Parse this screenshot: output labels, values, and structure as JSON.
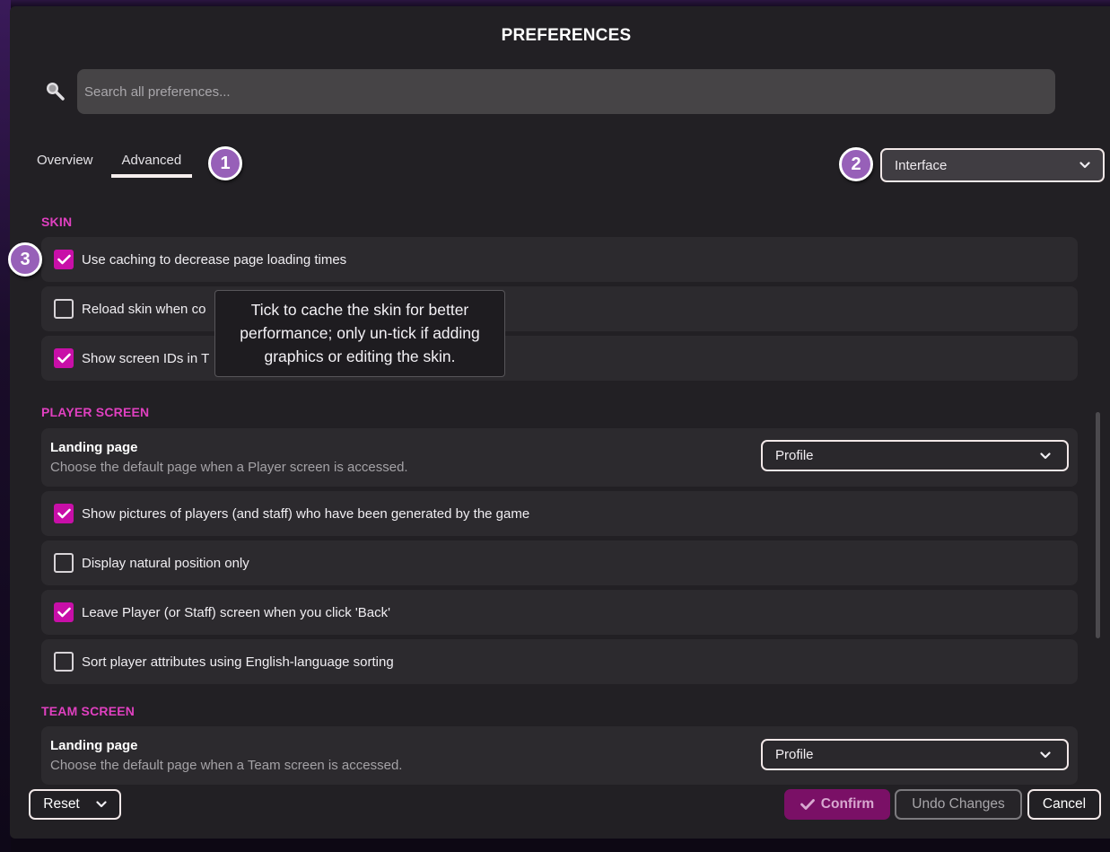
{
  "dialog": {
    "title": "PREFERENCES"
  },
  "search": {
    "placeholder": "Search all preferences...",
    "value": "",
    "icon": "search-icon"
  },
  "tabs": [
    {
      "label": "Overview",
      "active": false
    },
    {
      "label": "Advanced",
      "active": true
    }
  ],
  "badges": [
    "1",
    "2",
    "3"
  ],
  "category_select": {
    "value": "Interface",
    "icon": "chevron-down-icon"
  },
  "sections": {
    "skin": {
      "title": "SKIN",
      "items": [
        {
          "label": "Use caching to decrease page loading times",
          "checked": true
        },
        {
          "label": "Reload skin when co",
          "checked": false
        },
        {
          "label": "Show screen IDs in T",
          "checked": true
        }
      ]
    },
    "player_screen": {
      "title": "PLAYER SCREEN",
      "landing": {
        "title": "Landing page",
        "description": "Choose the default page when a Player screen is accessed.",
        "value": "Profile"
      },
      "items": [
        {
          "label": "Show pictures of players (and staff) who have been generated by the game",
          "checked": true
        },
        {
          "label": "Display natural position only",
          "checked": false
        },
        {
          "label": "Leave Player (or Staff) screen when you click 'Back'",
          "checked": true
        },
        {
          "label": "Sort player attributes using English-language sorting",
          "checked": false
        }
      ]
    },
    "team_screen": {
      "title": "TEAM SCREEN",
      "landing": {
        "title": "Landing page",
        "description": "Choose the default page when a Team screen is accessed.",
        "value": "Profile"
      }
    }
  },
  "tooltip": {
    "text": "Tick to cache the skin for better performance; only un-tick if adding graphics or editing the skin."
  },
  "footer": {
    "reset_label": "Reset",
    "confirm_label": "Confirm",
    "undo_label": "Undo Changes",
    "cancel_label": "Cancel"
  },
  "colors": {
    "accent": "#e040c0",
    "checkbox_on": "#c80fa8",
    "confirm_bg": "#7a1066",
    "badge": "#9760b8",
    "dialog_bg": "#222024",
    "row_bg": "#2c2a2e"
  }
}
